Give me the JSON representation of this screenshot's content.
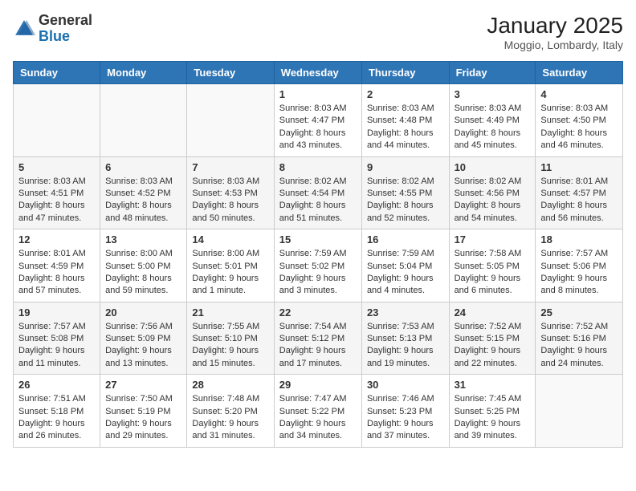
{
  "header": {
    "logo_general": "General",
    "logo_blue": "Blue",
    "month": "January 2025",
    "location": "Moggio, Lombardy, Italy"
  },
  "weekdays": [
    "Sunday",
    "Monday",
    "Tuesday",
    "Wednesday",
    "Thursday",
    "Friday",
    "Saturday"
  ],
  "weeks": [
    [
      {
        "day": "",
        "info": ""
      },
      {
        "day": "",
        "info": ""
      },
      {
        "day": "",
        "info": ""
      },
      {
        "day": "1",
        "info": "Sunrise: 8:03 AM\nSunset: 4:47 PM\nDaylight: 8 hours and 43 minutes."
      },
      {
        "day": "2",
        "info": "Sunrise: 8:03 AM\nSunset: 4:48 PM\nDaylight: 8 hours and 44 minutes."
      },
      {
        "day": "3",
        "info": "Sunrise: 8:03 AM\nSunset: 4:49 PM\nDaylight: 8 hours and 45 minutes."
      },
      {
        "day": "4",
        "info": "Sunrise: 8:03 AM\nSunset: 4:50 PM\nDaylight: 8 hours and 46 minutes."
      }
    ],
    [
      {
        "day": "5",
        "info": "Sunrise: 8:03 AM\nSunset: 4:51 PM\nDaylight: 8 hours and 47 minutes."
      },
      {
        "day": "6",
        "info": "Sunrise: 8:03 AM\nSunset: 4:52 PM\nDaylight: 8 hours and 48 minutes."
      },
      {
        "day": "7",
        "info": "Sunrise: 8:03 AM\nSunset: 4:53 PM\nDaylight: 8 hours and 50 minutes."
      },
      {
        "day": "8",
        "info": "Sunrise: 8:02 AM\nSunset: 4:54 PM\nDaylight: 8 hours and 51 minutes."
      },
      {
        "day": "9",
        "info": "Sunrise: 8:02 AM\nSunset: 4:55 PM\nDaylight: 8 hours and 52 minutes."
      },
      {
        "day": "10",
        "info": "Sunrise: 8:02 AM\nSunset: 4:56 PM\nDaylight: 8 hours and 54 minutes."
      },
      {
        "day": "11",
        "info": "Sunrise: 8:01 AM\nSunset: 4:57 PM\nDaylight: 8 hours and 56 minutes."
      }
    ],
    [
      {
        "day": "12",
        "info": "Sunrise: 8:01 AM\nSunset: 4:59 PM\nDaylight: 8 hours and 57 minutes."
      },
      {
        "day": "13",
        "info": "Sunrise: 8:00 AM\nSunset: 5:00 PM\nDaylight: 8 hours and 59 minutes."
      },
      {
        "day": "14",
        "info": "Sunrise: 8:00 AM\nSunset: 5:01 PM\nDaylight: 9 hours and 1 minute."
      },
      {
        "day": "15",
        "info": "Sunrise: 7:59 AM\nSunset: 5:02 PM\nDaylight: 9 hours and 3 minutes."
      },
      {
        "day": "16",
        "info": "Sunrise: 7:59 AM\nSunset: 5:04 PM\nDaylight: 9 hours and 4 minutes."
      },
      {
        "day": "17",
        "info": "Sunrise: 7:58 AM\nSunset: 5:05 PM\nDaylight: 9 hours and 6 minutes."
      },
      {
        "day": "18",
        "info": "Sunrise: 7:57 AM\nSunset: 5:06 PM\nDaylight: 9 hours and 8 minutes."
      }
    ],
    [
      {
        "day": "19",
        "info": "Sunrise: 7:57 AM\nSunset: 5:08 PM\nDaylight: 9 hours and 11 minutes."
      },
      {
        "day": "20",
        "info": "Sunrise: 7:56 AM\nSunset: 5:09 PM\nDaylight: 9 hours and 13 minutes."
      },
      {
        "day": "21",
        "info": "Sunrise: 7:55 AM\nSunset: 5:10 PM\nDaylight: 9 hours and 15 minutes."
      },
      {
        "day": "22",
        "info": "Sunrise: 7:54 AM\nSunset: 5:12 PM\nDaylight: 9 hours and 17 minutes."
      },
      {
        "day": "23",
        "info": "Sunrise: 7:53 AM\nSunset: 5:13 PM\nDaylight: 9 hours and 19 minutes."
      },
      {
        "day": "24",
        "info": "Sunrise: 7:52 AM\nSunset: 5:15 PM\nDaylight: 9 hours and 22 minutes."
      },
      {
        "day": "25",
        "info": "Sunrise: 7:52 AM\nSunset: 5:16 PM\nDaylight: 9 hours and 24 minutes."
      }
    ],
    [
      {
        "day": "26",
        "info": "Sunrise: 7:51 AM\nSunset: 5:18 PM\nDaylight: 9 hours and 26 minutes."
      },
      {
        "day": "27",
        "info": "Sunrise: 7:50 AM\nSunset: 5:19 PM\nDaylight: 9 hours and 29 minutes."
      },
      {
        "day": "28",
        "info": "Sunrise: 7:48 AM\nSunset: 5:20 PM\nDaylight: 9 hours and 31 minutes."
      },
      {
        "day": "29",
        "info": "Sunrise: 7:47 AM\nSunset: 5:22 PM\nDaylight: 9 hours and 34 minutes."
      },
      {
        "day": "30",
        "info": "Sunrise: 7:46 AM\nSunset: 5:23 PM\nDaylight: 9 hours and 37 minutes."
      },
      {
        "day": "31",
        "info": "Sunrise: 7:45 AM\nSunset: 5:25 PM\nDaylight: 9 hours and 39 minutes."
      },
      {
        "day": "",
        "info": ""
      }
    ]
  ]
}
